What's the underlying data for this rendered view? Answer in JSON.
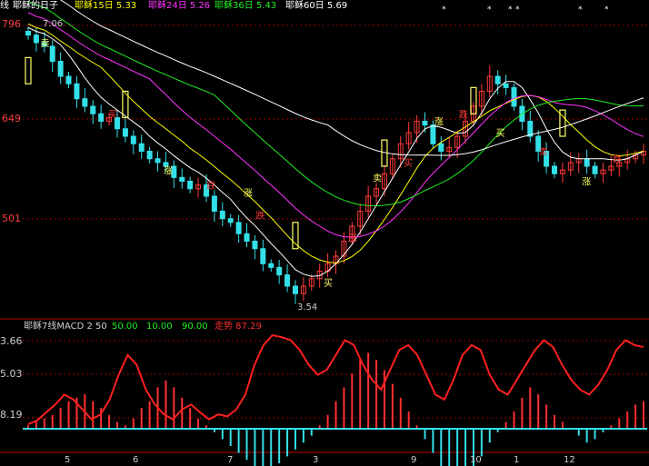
{
  "colors": {
    "bg": "#000000",
    "up": "#ff3a3a",
    "down": "#33e0e8",
    "ma_short": "#ffffff",
    "ma15": "#ffff00",
    "ma24": "#ff33ff",
    "ma36": "#22ee22",
    "ma60": "#ffffff",
    "grid": "#9a0000",
    "panel_sep": "#c00000",
    "macd_up": "#ff3030",
    "macd_down": "#33e0e8",
    "trend": "#ff2020",
    "signal": "#ffff66"
  },
  "header": {
    "left_char": "线",
    "items": [
      {
        "text": "耶稣的日子",
        "color": "#ffffff"
      },
      {
        "text": "耶稣15日 5.33",
        "color": "#ffff00"
      },
      {
        "text": "耶稣24日 5.26",
        "color": "#ff33ff"
      },
      {
        "text": "耶稣36日 5.43",
        "color": "#22ee22"
      },
      {
        "text": "耶稣60日 5.69",
        "color": "#ffffff"
      }
    ]
  },
  "price_axis": {
    "labels": [
      "796",
      "649",
      "501"
    ]
  },
  "macd_header": {
    "items": [
      {
        "text": "耶稣7线MACD 2 50",
        "color": "#cfcfcf"
      },
      {
        "text": "50.00",
        "color": "#22ee22"
      },
      {
        "text": "10.00",
        "color": "#22ee22"
      },
      {
        "text": "90.00",
        "color": "#22ee22"
      },
      {
        "text": "走势 87.29",
        "color": "#ff3030"
      }
    ]
  },
  "macd_axis": {
    "labels": [
      "3.66",
      "5.03",
      "8.19"
    ]
  },
  "x_axis": {
    "labels": [
      "5",
      "6",
      "7",
      "3",
      "9",
      "10",
      "1",
      "12"
    ]
  },
  "annotations": {
    "high_label": "7.06",
    "low_label": "3.54",
    "signals": [
      "卖",
      "买",
      "涨",
      "跌",
      "涨",
      "跌",
      "买",
      "涨",
      "卖",
      "买",
      "涨",
      "跌",
      "买",
      "卖",
      "涨",
      "跌"
    ]
  },
  "chart_data": {
    "type": "candlestick",
    "title": "",
    "xlabel": "",
    "ylabel": "",
    "ylim": [
      3.3,
      7.3
    ],
    "ma_labels": [
      "耶稣15日 5.33",
      "耶稣24日 5.26",
      "耶稣36日 5.43",
      "耶稣60日 5.69"
    ],
    "closes": [
      7.05,
      6.95,
      6.9,
      6.7,
      6.5,
      6.4,
      6.2,
      6.1,
      6.0,
      5.9,
      5.95,
      5.8,
      5.7,
      5.6,
      5.5,
      5.4,
      5.35,
      5.3,
      5.15,
      5.1,
      5.0,
      5.05,
      4.9,
      4.7,
      4.6,
      4.55,
      4.4,
      4.3,
      4.2,
      4.0,
      3.95,
      3.85,
      3.7,
      3.6,
      3.7,
      3.8,
      3.9,
      4.0,
      4.1,
      4.3,
      4.5,
      4.7,
      4.9,
      5.0,
      5.2,
      5.4,
      5.6,
      5.75,
      5.9,
      5.85,
      5.6,
      5.5,
      5.55,
      5.7,
      5.9,
      6.1,
      6.3,
      6.5,
      6.4,
      6.35,
      6.1,
      5.9,
      5.7,
      5.5,
      5.3,
      5.2,
      5.25,
      5.35,
      5.4,
      5.3,
      5.2,
      5.25,
      5.3,
      5.35,
      5.4,
      5.45,
      5.5
    ],
    "macd_histogram": [
      0.1,
      0.2,
      0.3,
      0.4,
      0.6,
      0.8,
      0.9,
      1.0,
      0.8,
      0.6,
      0.4,
      0.2,
      0.1,
      0.3,
      0.6,
      0.8,
      1.2,
      1.4,
      1.2,
      0.9,
      0.6,
      0.3,
      0.1,
      -0.1,
      -0.3,
      -0.5,
      -0.7,
      -0.9,
      -1.1,
      -1.3,
      -1.2,
      -1.0,
      -0.8,
      -0.6,
      -0.4,
      -0.2,
      0.1,
      0.4,
      0.8,
      1.2,
      1.6,
      2.0,
      2.2,
      2.0,
      1.7,
      1.3,
      0.9,
      0.5,
      0.1,
      -0.3,
      -0.7,
      -1.1,
      -1.4,
      -1.6,
      -1.5,
      -1.2,
      -0.8,
      -0.4,
      -0.1,
      0.2,
      0.5,
      0.9,
      1.2,
      1.0,
      0.7,
      0.4,
      0.2,
      0.0,
      -0.2,
      -0.4,
      -0.3,
      -0.1,
      0.1,
      0.3,
      0.5,
      0.7,
      0.8
    ],
    "trend": [
      10,
      14,
      22,
      30,
      40,
      35,
      25,
      15,
      20,
      35,
      60,
      80,
      70,
      45,
      30,
      20,
      15,
      25,
      30,
      22,
      15,
      20,
      18,
      25,
      40,
      70,
      90,
      100,
      98,
      95,
      85,
      70,
      60,
      65,
      80,
      95,
      90,
      70,
      55,
      45,
      65,
      85,
      90,
      80,
      60,
      40,
      35,
      55,
      80,
      90,
      85,
      60,
      45,
      40,
      55,
      70,
      85,
      95,
      88,
      70,
      55,
      45,
      40,
      50,
      65,
      85,
      95,
      90,
      88
    ]
  }
}
